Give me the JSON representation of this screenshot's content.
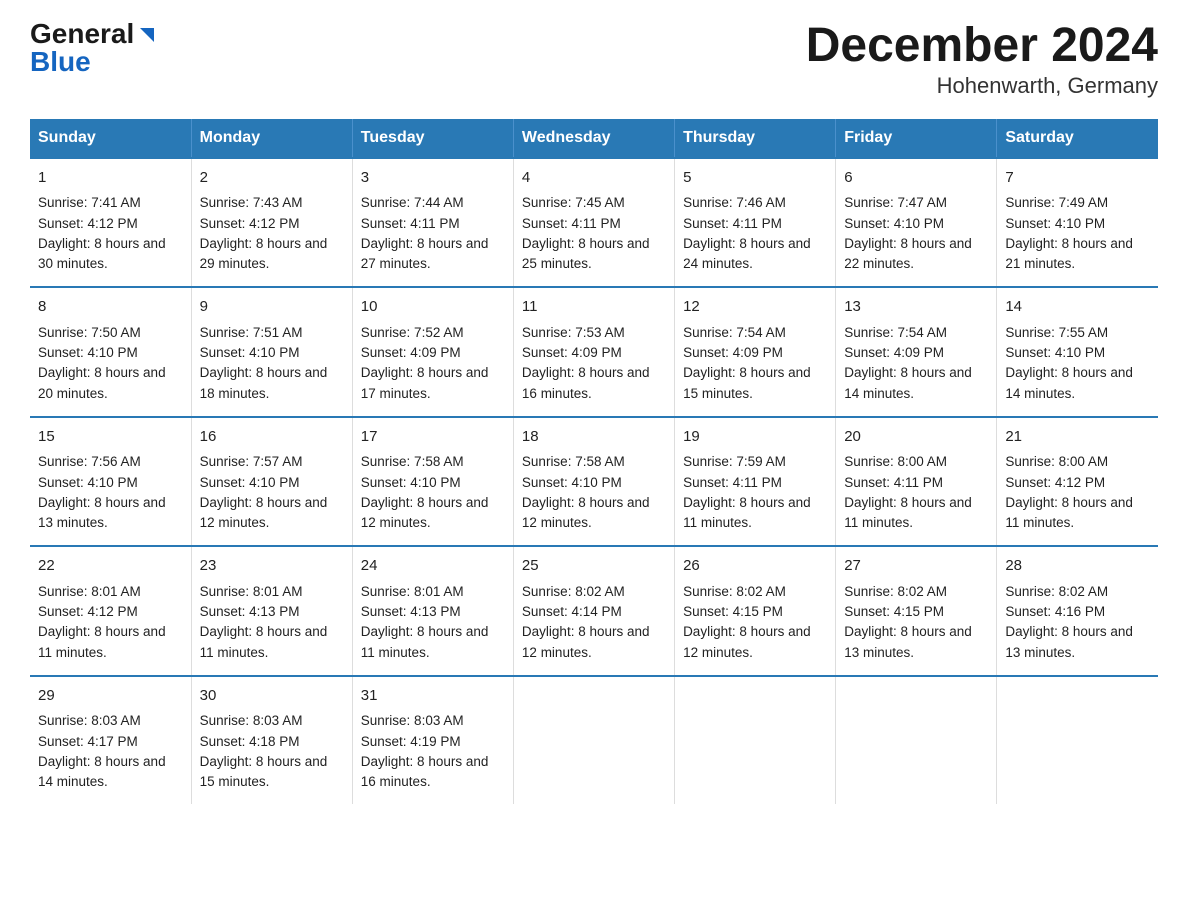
{
  "logo": {
    "general": "General",
    "triangle": "▶",
    "blue": "Blue"
  },
  "title": "December 2024",
  "subtitle": "Hohenwarth, Germany",
  "headers": [
    "Sunday",
    "Monday",
    "Tuesday",
    "Wednesday",
    "Thursday",
    "Friday",
    "Saturday"
  ],
  "weeks": [
    [
      {
        "day": "1",
        "sunrise": "Sunrise: 7:41 AM",
        "sunset": "Sunset: 4:12 PM",
        "daylight": "Daylight: 8 hours and 30 minutes."
      },
      {
        "day": "2",
        "sunrise": "Sunrise: 7:43 AM",
        "sunset": "Sunset: 4:12 PM",
        "daylight": "Daylight: 8 hours and 29 minutes."
      },
      {
        "day": "3",
        "sunrise": "Sunrise: 7:44 AM",
        "sunset": "Sunset: 4:11 PM",
        "daylight": "Daylight: 8 hours and 27 minutes."
      },
      {
        "day": "4",
        "sunrise": "Sunrise: 7:45 AM",
        "sunset": "Sunset: 4:11 PM",
        "daylight": "Daylight: 8 hours and 25 minutes."
      },
      {
        "day": "5",
        "sunrise": "Sunrise: 7:46 AM",
        "sunset": "Sunset: 4:11 PM",
        "daylight": "Daylight: 8 hours and 24 minutes."
      },
      {
        "day": "6",
        "sunrise": "Sunrise: 7:47 AM",
        "sunset": "Sunset: 4:10 PM",
        "daylight": "Daylight: 8 hours and 22 minutes."
      },
      {
        "day": "7",
        "sunrise": "Sunrise: 7:49 AM",
        "sunset": "Sunset: 4:10 PM",
        "daylight": "Daylight: 8 hours and 21 minutes."
      }
    ],
    [
      {
        "day": "8",
        "sunrise": "Sunrise: 7:50 AM",
        "sunset": "Sunset: 4:10 PM",
        "daylight": "Daylight: 8 hours and 20 minutes."
      },
      {
        "day": "9",
        "sunrise": "Sunrise: 7:51 AM",
        "sunset": "Sunset: 4:10 PM",
        "daylight": "Daylight: 8 hours and 18 minutes."
      },
      {
        "day": "10",
        "sunrise": "Sunrise: 7:52 AM",
        "sunset": "Sunset: 4:09 PM",
        "daylight": "Daylight: 8 hours and 17 minutes."
      },
      {
        "day": "11",
        "sunrise": "Sunrise: 7:53 AM",
        "sunset": "Sunset: 4:09 PM",
        "daylight": "Daylight: 8 hours and 16 minutes."
      },
      {
        "day": "12",
        "sunrise": "Sunrise: 7:54 AM",
        "sunset": "Sunset: 4:09 PM",
        "daylight": "Daylight: 8 hours and 15 minutes."
      },
      {
        "day": "13",
        "sunrise": "Sunrise: 7:54 AM",
        "sunset": "Sunset: 4:09 PM",
        "daylight": "Daylight: 8 hours and 14 minutes."
      },
      {
        "day": "14",
        "sunrise": "Sunrise: 7:55 AM",
        "sunset": "Sunset: 4:10 PM",
        "daylight": "Daylight: 8 hours and 14 minutes."
      }
    ],
    [
      {
        "day": "15",
        "sunrise": "Sunrise: 7:56 AM",
        "sunset": "Sunset: 4:10 PM",
        "daylight": "Daylight: 8 hours and 13 minutes."
      },
      {
        "day": "16",
        "sunrise": "Sunrise: 7:57 AM",
        "sunset": "Sunset: 4:10 PM",
        "daylight": "Daylight: 8 hours and 12 minutes."
      },
      {
        "day": "17",
        "sunrise": "Sunrise: 7:58 AM",
        "sunset": "Sunset: 4:10 PM",
        "daylight": "Daylight: 8 hours and 12 minutes."
      },
      {
        "day": "18",
        "sunrise": "Sunrise: 7:58 AM",
        "sunset": "Sunset: 4:10 PM",
        "daylight": "Daylight: 8 hours and 12 minutes."
      },
      {
        "day": "19",
        "sunrise": "Sunrise: 7:59 AM",
        "sunset": "Sunset: 4:11 PM",
        "daylight": "Daylight: 8 hours and 11 minutes."
      },
      {
        "day": "20",
        "sunrise": "Sunrise: 8:00 AM",
        "sunset": "Sunset: 4:11 PM",
        "daylight": "Daylight: 8 hours and 11 minutes."
      },
      {
        "day": "21",
        "sunrise": "Sunrise: 8:00 AM",
        "sunset": "Sunset: 4:12 PM",
        "daylight": "Daylight: 8 hours and 11 minutes."
      }
    ],
    [
      {
        "day": "22",
        "sunrise": "Sunrise: 8:01 AM",
        "sunset": "Sunset: 4:12 PM",
        "daylight": "Daylight: 8 hours and 11 minutes."
      },
      {
        "day": "23",
        "sunrise": "Sunrise: 8:01 AM",
        "sunset": "Sunset: 4:13 PM",
        "daylight": "Daylight: 8 hours and 11 minutes."
      },
      {
        "day": "24",
        "sunrise": "Sunrise: 8:01 AM",
        "sunset": "Sunset: 4:13 PM",
        "daylight": "Daylight: 8 hours and 11 minutes."
      },
      {
        "day": "25",
        "sunrise": "Sunrise: 8:02 AM",
        "sunset": "Sunset: 4:14 PM",
        "daylight": "Daylight: 8 hours and 12 minutes."
      },
      {
        "day": "26",
        "sunrise": "Sunrise: 8:02 AM",
        "sunset": "Sunset: 4:15 PM",
        "daylight": "Daylight: 8 hours and 12 minutes."
      },
      {
        "day": "27",
        "sunrise": "Sunrise: 8:02 AM",
        "sunset": "Sunset: 4:15 PM",
        "daylight": "Daylight: 8 hours and 13 minutes."
      },
      {
        "day": "28",
        "sunrise": "Sunrise: 8:02 AM",
        "sunset": "Sunset: 4:16 PM",
        "daylight": "Daylight: 8 hours and 13 minutes."
      }
    ],
    [
      {
        "day": "29",
        "sunrise": "Sunrise: 8:03 AM",
        "sunset": "Sunset: 4:17 PM",
        "daylight": "Daylight: 8 hours and 14 minutes."
      },
      {
        "day": "30",
        "sunrise": "Sunrise: 8:03 AM",
        "sunset": "Sunset: 4:18 PM",
        "daylight": "Daylight: 8 hours and 15 minutes."
      },
      {
        "day": "31",
        "sunrise": "Sunrise: 8:03 AM",
        "sunset": "Sunset: 4:19 PM",
        "daylight": "Daylight: 8 hours and 16 minutes."
      },
      null,
      null,
      null,
      null
    ]
  ]
}
